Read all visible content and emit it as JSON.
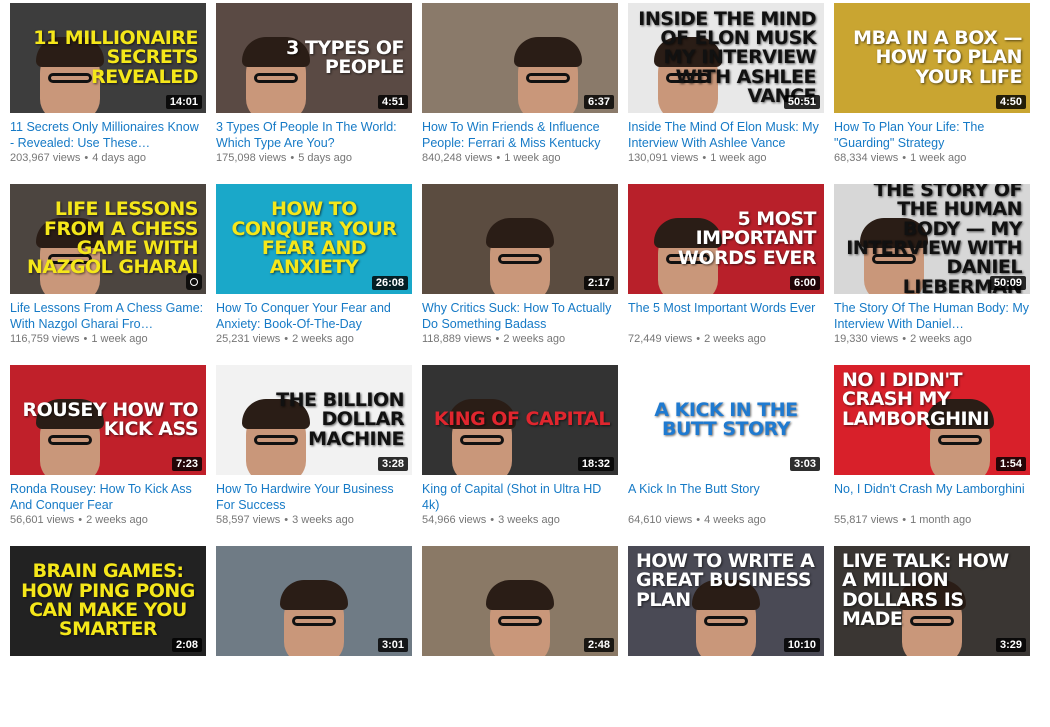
{
  "videos": [
    {
      "thumb_text": "11 Millionaire Secrets Revealed",
      "text_color": "#f5e71a",
      "bg": "#3d3d3d",
      "face": "left",
      "align": "right",
      "duration": "14:01",
      "title": "11 Secrets Only Millionaires Know - Revealed: Use These…",
      "views": "203,967 views",
      "age": "4 days ago"
    },
    {
      "thumb_text": "3 Types of People",
      "text_color": "#ffffff",
      "bg": "#5a4a44",
      "face": "left",
      "align": "right",
      "duration": "4:51",
      "title": "3 Types Of People In The World: Which Type Are You?",
      "views": "175,098 views",
      "age": "5 days ago"
    },
    {
      "thumb_text": "",
      "text_color": "#ffffff",
      "bg": "#8a7a6a",
      "face": "right",
      "align": "right",
      "duration": "6:37",
      "title": "How To Win Friends & Influence People: Ferrari & Miss Kentucky",
      "views": "840,248 views",
      "age": "1 week ago"
    },
    {
      "thumb_text": "Inside the Mind of Elon Musk My Interview with Ashlee Vance",
      "text_color": "#111111",
      "bg": "#e8e8e8",
      "face": "left",
      "align": "right",
      "duration": "50:51",
      "title": "Inside The Mind Of Elon Musk: My Interview With Ashlee Vance",
      "views": "130,091 views",
      "age": "1 week ago"
    },
    {
      "thumb_text": "MBA in a Box — How to Plan Your Life",
      "text_color": "#ffffff",
      "bg": "#c9a531",
      "face": "none",
      "align": "right",
      "duration": "4:50",
      "title": "How To Plan Your Life: The \"Guarding\" Strategy",
      "views": "68,334 views",
      "age": "1 week ago"
    },
    {
      "thumb_text": "Life Lessons from a Chess Game with Nazgol Gharai",
      "text_color": "#f5e71a",
      "bg": "#4c4540",
      "face": "left",
      "align": "right",
      "duration": "",
      "title": "Life Lessons From A Chess Game: With Nazgol Gharai Fro…",
      "views": "116,759 views",
      "age": "1 week ago"
    },
    {
      "thumb_text": "How to Conquer Your Fear and Anxiety",
      "text_color": "#f5e71a",
      "bg": "#1aa8c9",
      "face": "none",
      "align": "center",
      "duration": "26:08",
      "title": "How To Conquer Your Fear and Anxiety: Book-Of-The-Day",
      "views": "25,231 views",
      "age": "2 weeks ago"
    },
    {
      "thumb_text": "",
      "text_color": "#ffffff",
      "bg": "#5b4c40",
      "face": "center",
      "align": "right",
      "duration": "2:17",
      "title": "Why Critics Suck: How To Actually Do Something Badass",
      "views": "118,889 views",
      "age": "2 weeks ago"
    },
    {
      "thumb_text": "5 Most Important Words Ever",
      "text_color": "#ffffff",
      "bg": "#b8202a",
      "face": "left",
      "align": "right",
      "duration": "6:00",
      "title": "The 5 Most Important Words Ever",
      "views": "72,449 views",
      "age": "2 weeks ago"
    },
    {
      "thumb_text": "The Story of the Human Body — My Interview with Daniel Lieberman",
      "text_color": "#111111",
      "bg": "#d7d7d7",
      "face": "left",
      "align": "right",
      "duration": "50:09",
      "title": "The Story Of The Human Body: My Interview With Daniel…",
      "views": "19,330 views",
      "age": "2 weeks ago"
    },
    {
      "thumb_text": "Rousey How to Kick Ass",
      "text_color": "#ffffff",
      "bg": "#c0202a",
      "face": "left",
      "align": "right",
      "duration": "7:23",
      "title": "Ronda Rousey: How To Kick Ass And Conquer Fear",
      "views": "56,601 views",
      "age": "2 weeks ago"
    },
    {
      "thumb_text": "The Billion Dollar Machine",
      "text_color": "#111111",
      "bg": "#f2f2f2",
      "face": "left",
      "align": "right",
      "duration": "3:28",
      "title": "How To Hardwire Your Business For Success",
      "views": "58,597 views",
      "age": "3 weeks ago"
    },
    {
      "thumb_text": "King of Capital",
      "text_color": "#e0262e",
      "bg": "#333333",
      "face": "left",
      "align": "right",
      "duration": "18:32",
      "title": "King of Capital (Shot in Ultra HD 4k)",
      "views": "54,966 views",
      "age": "3 weeks ago"
    },
    {
      "thumb_text": "A kick in the Butt Story",
      "text_color": "#1f7ad0",
      "bg": "#ffffff",
      "face": "none",
      "align": "center",
      "duration": "3:03",
      "title": "A Kick In The Butt Story",
      "views": "64,610 views",
      "age": "4 weeks ago"
    },
    {
      "thumb_text": "No I Didn't Crash My Lamborghini",
      "text_color": "#ffffff",
      "bg": "#d8202a",
      "face": "right",
      "align": "left",
      "duration": "1:54",
      "title": "No, I Didn't Crash My Lamborghini",
      "views": "55,817 views",
      "age": "1 month ago"
    },
    {
      "thumb_text": "Brain Games: How Ping Pong Can Make You Smarter",
      "text_color": "#f5e71a",
      "bg": "#222222",
      "face": "none",
      "align": "center",
      "duration": "2:08",
      "title": "",
      "views": "",
      "age": ""
    },
    {
      "thumb_text": "",
      "text_color": "#ffffff",
      "bg": "#6f7b85",
      "face": "center",
      "align": "right",
      "duration": "3:01",
      "title": "",
      "views": "",
      "age": ""
    },
    {
      "thumb_text": "",
      "text_color": "#ffffff",
      "bg": "#8a7966",
      "face": "center",
      "align": "right",
      "duration": "2:48",
      "title": "",
      "views": "",
      "age": ""
    },
    {
      "thumb_text": "How to Write a Great Business Plan",
      "text_color": "#ffffff",
      "bg": "#4a4a55",
      "face": "center",
      "align": "left",
      "duration": "10:10",
      "title": "",
      "views": "",
      "age": ""
    },
    {
      "thumb_text": "Live Talk: How A Million Dollars Is Made",
      "text_color": "#ffffff",
      "bg": "#3a3633",
      "face": "center",
      "align": "left",
      "duration": "3:29",
      "title": "",
      "views": "",
      "age": ""
    }
  ]
}
